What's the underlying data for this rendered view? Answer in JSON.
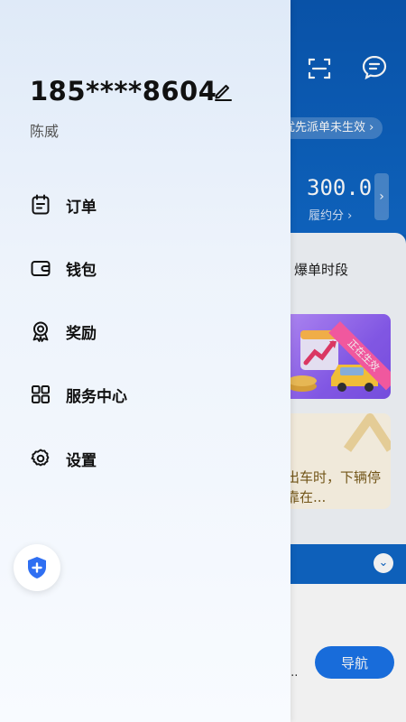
{
  "background": {
    "pill_text": "优先派单未生效",
    "pill_arrow": "›",
    "score_value": "300.0",
    "score_label": "履约分 ›",
    "score_arrow": "›",
    "tab_label": "爆单时段",
    "banner_ribbon": "正在生效",
    "notice_text": "出车时，下辆停靠在...",
    "collapse_icon": "chevron-down-icon",
    "nav_button": "导航",
    "ellipsis": "...",
    "colors": {
      "header": "#0d5fb8",
      "nav_button": "#1a73e8",
      "banner": "#8a5df2",
      "ribbon": "#ff5ea8"
    }
  },
  "drawer": {
    "phone": "185****8604",
    "name": "陈威",
    "menu": [
      {
        "label": "订单",
        "icon": "order-icon"
      },
      {
        "label": "钱包",
        "icon": "wallet-icon"
      },
      {
        "label": "奖励",
        "icon": "reward-icon"
      },
      {
        "label": "服务中心",
        "icon": "service-center-icon"
      },
      {
        "label": "设置",
        "icon": "settings-icon"
      }
    ],
    "safety_icon": "safety-shield-icon",
    "colors": {
      "shield": "#2f6ff2",
      "text": "#111111",
      "subtext": "#555555"
    }
  }
}
